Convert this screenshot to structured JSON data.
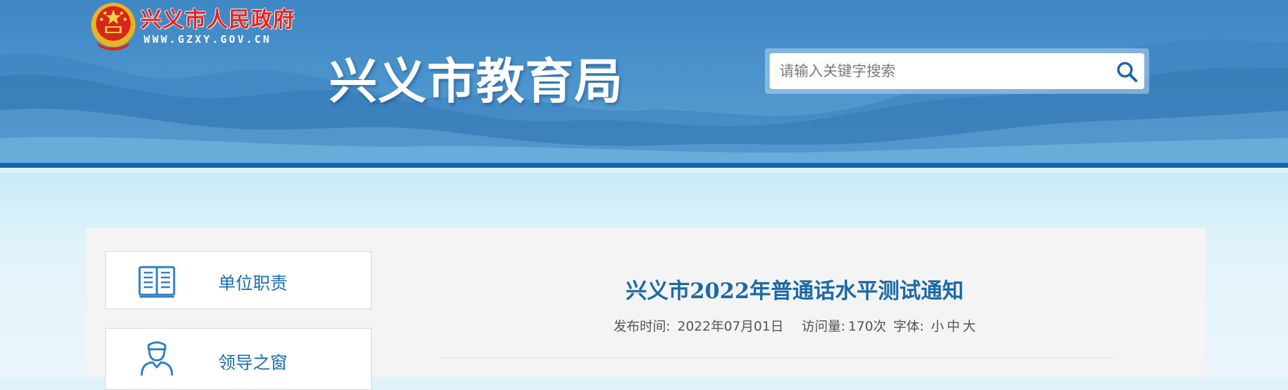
{
  "header": {
    "gov_name": "兴义市人民政府",
    "gov_url": "WWW.GZXY.GOV.CN",
    "site_title": "兴义市教育局",
    "search": {
      "placeholder": "请输入关键字搜索",
      "value": ""
    }
  },
  "sidebar": {
    "items": [
      {
        "label": "单位职责",
        "icon": "book-icon"
      },
      {
        "label": "领导之窗",
        "icon": "person-icon"
      }
    ]
  },
  "article": {
    "title": "兴义市2022年普通话水平测试通知",
    "publish_label": "发布时间:",
    "publish_date": "2022年07月01日",
    "views_label": "访问量:",
    "views_value": "170次",
    "font_label": "字体:",
    "font_small": "小",
    "font_medium": "中",
    "font_large": "大"
  },
  "colors": {
    "header_blue": "#4a93cc",
    "header_bar": "#0b68b0",
    "title_blue": "#1b6aa8",
    "gov_red": "#e6251f"
  }
}
